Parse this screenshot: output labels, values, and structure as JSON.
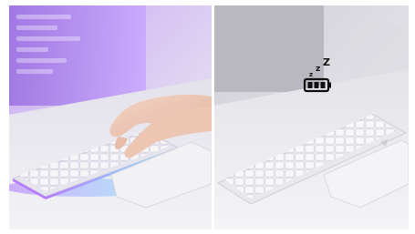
{
  "panels": [
    {
      "id": "keyboard-active",
      "state": "active",
      "backlight": "on",
      "hands": true
    },
    {
      "id": "keyboard-sleep",
      "state": "sleep",
      "backlight": "off",
      "hands": false,
      "sleep_glyph": "zzZ"
    }
  ],
  "colors": {
    "backlight_purple": "#b57cff",
    "backlight_cyan": "#7fe3ff",
    "keycap": "#f3f3f6",
    "desk": "#e9e9ee",
    "battery_icon": "#111111"
  },
  "icons": [
    "battery-icon",
    "sleep-zzz-icon"
  ]
}
